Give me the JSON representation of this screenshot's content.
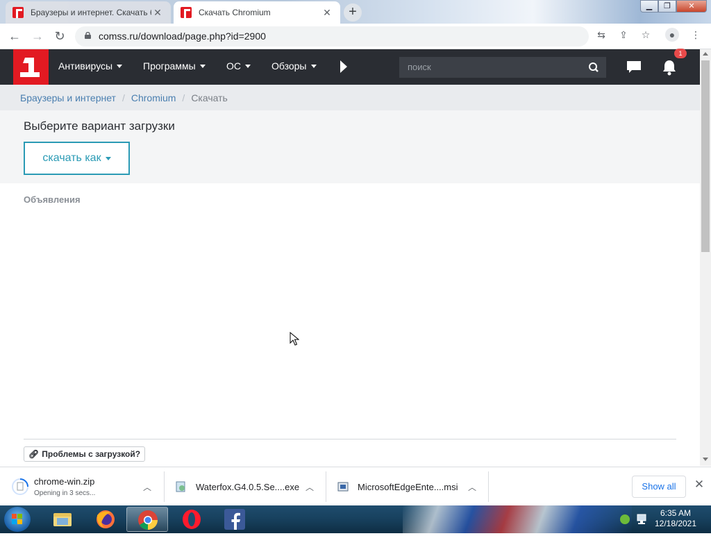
{
  "browser": {
    "tabs": [
      {
        "title": "Браузеры и интернет. Скачать б",
        "active": false
      },
      {
        "title": "Скачать Chromium",
        "active": true
      }
    ],
    "url": "comss.ru/download/page.php?id=2900"
  },
  "site": {
    "menu": [
      {
        "label": "Антивирусы"
      },
      {
        "label": "Программы"
      },
      {
        "label": "ОС"
      },
      {
        "label": "Обзоры"
      }
    ],
    "search_placeholder": "поиск",
    "notifications_count": "1"
  },
  "breadcrumb": {
    "items": [
      "Браузеры и интернет",
      "Chromium",
      "Скачать"
    ]
  },
  "page": {
    "heading": "Выберите вариант загрузки",
    "download_as_label": "скачать как",
    "ads_label": "Объявления",
    "problems_label": "Проблемы с загрузкой?"
  },
  "downloads": {
    "items": [
      {
        "name": "chrome-win.zip",
        "status": "Opening in 3 secs..."
      },
      {
        "name": "Waterfox.G4.0.5.Se....exe",
        "status": ""
      },
      {
        "name": "MicrosoftEdgeEnte....msi",
        "status": ""
      }
    ],
    "show_all_label": "Show all"
  },
  "taskbar": {
    "time": "6:35 AM",
    "date": "12/18/2021",
    "pinned": [
      "windows-explorer",
      "firefox",
      "chrome",
      "opera",
      "facebook"
    ]
  },
  "colors": {
    "brand_red": "#e21a22",
    "header_dark": "#2a2d33",
    "accent_teal": "#2b9bb5",
    "link_blue": "#4a7fb0",
    "chrome_blue": "#1a73e8"
  }
}
